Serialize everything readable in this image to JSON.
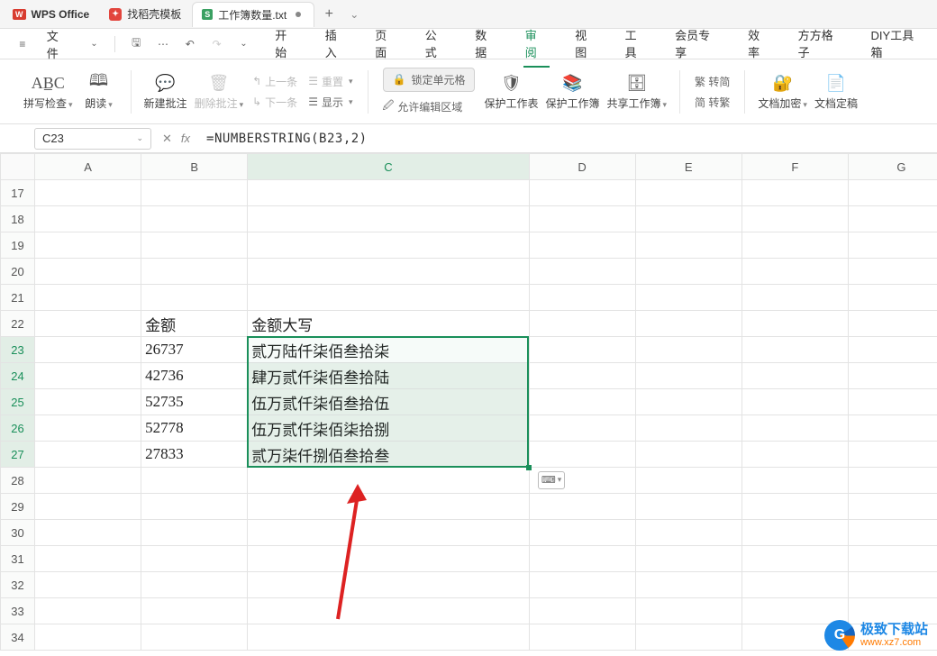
{
  "titlebar": {
    "app_name": "WPS Office",
    "tabs": [
      {
        "label": "找稻壳模板",
        "icon": "template"
      },
      {
        "label": "工作簿数量.txt",
        "icon": "sheet",
        "dirty": true
      }
    ],
    "new_tab_label": "+"
  },
  "menu": {
    "file_label": "文件",
    "ribbon": [
      {
        "key": "start",
        "label": "开始"
      },
      {
        "key": "insert",
        "label": "插入"
      },
      {
        "key": "page",
        "label": "页面"
      },
      {
        "key": "formula",
        "label": "公式"
      },
      {
        "key": "data",
        "label": "数据"
      },
      {
        "key": "review",
        "label": "审阅"
      },
      {
        "key": "view",
        "label": "视图"
      },
      {
        "key": "tools",
        "label": "工具"
      },
      {
        "key": "vip",
        "label": "会员专享"
      },
      {
        "key": "performance",
        "label": "效率"
      },
      {
        "key": "square",
        "label": "方方格子"
      },
      {
        "key": "diy",
        "label": "DIY工具箱"
      }
    ],
    "active_ribbon": "review"
  },
  "ribbon": {
    "spellcheck": "拼写检查",
    "read_aloud": "朗读",
    "new_comment": "新建批注",
    "delete_comment": "删除批注",
    "prev": "上一条",
    "next": "下一条",
    "reset": "重置",
    "show": "显示",
    "lock_cells": "锁定单元格",
    "allow_edit": "允许编辑区域",
    "protect_sheet": "保护工作表",
    "protect_book": "保护工作簿",
    "share_book": "共享工作簿",
    "sc2tc": "繁 转简",
    "tc2sc": "简 转繁",
    "encrypt": "文档加密",
    "finalize": "文档定稿"
  },
  "formula_bar": {
    "name_box": "C23",
    "fx_label": "fx",
    "formula": "=NUMBERSTRING(B23,2)"
  },
  "grid": {
    "columns": [
      "A",
      "B",
      "C",
      "D",
      "E",
      "F",
      "G"
    ],
    "first_row": 17,
    "selected_rows": [
      23,
      24,
      25,
      26,
      27
    ],
    "selected_col": "C"
  },
  "data": {
    "header_B": "金额",
    "header_C": "金额大写",
    "rows": [
      {
        "row": 23,
        "amount": "26737",
        "text": "贰万陆仟柒佰叁拾柒"
      },
      {
        "row": 24,
        "amount": "42736",
        "text": "肆万贰仟柒佰叁拾陆"
      },
      {
        "row": 25,
        "amount": "52735",
        "text": "伍万贰仟柒佰叁拾伍"
      },
      {
        "row": 26,
        "amount": "52778",
        "text": "伍万贰仟柒佰柒拾捌"
      },
      {
        "row": 27,
        "amount": "27833",
        "text": "贰万柒仟捌佰叁拾叁"
      }
    ]
  },
  "branding": {
    "cn": "极致下载站",
    "en": "www.xz7.com"
  }
}
